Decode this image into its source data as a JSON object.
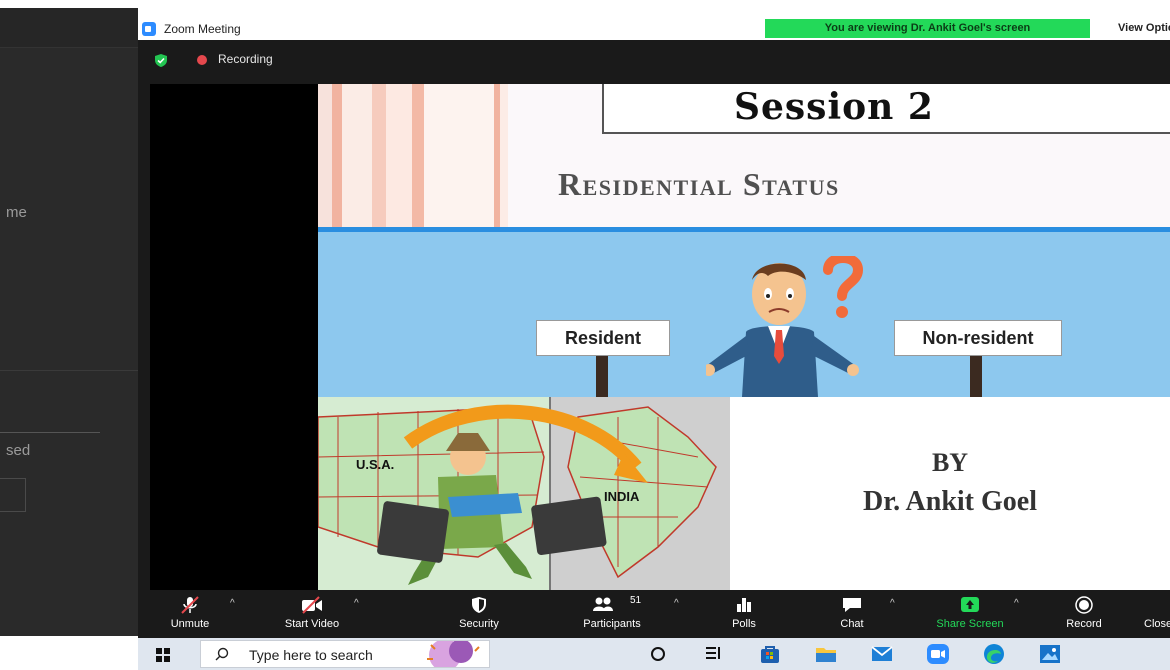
{
  "background_app": {
    "fragment_1": "me",
    "fragment_2": "sed"
  },
  "window": {
    "title": "Zoom Meeting",
    "viewing_banner": "You are viewing Dr. Ankit Goel's screen",
    "view_options": "View Options"
  },
  "status": {
    "recording_label": "Recording"
  },
  "slide": {
    "session_title": "Session 2",
    "heading": "Residential Status",
    "sign_left": "Resident",
    "sign_right": "Non-resident",
    "map_label_usa": "U.S.A.",
    "map_label_india": "INDIA",
    "by": "BY",
    "presenter": "Dr. Ankit Goel"
  },
  "toolbar": {
    "unmute": "Unmute",
    "start_video": "Start Video",
    "security": "Security",
    "participants": "Participants",
    "participants_count": "51",
    "polls": "Polls",
    "chat": "Chat",
    "share_screen": "Share Screen",
    "record": "Record",
    "close": "Close"
  },
  "taskbar": {
    "search_placeholder": "Type here to search"
  },
  "colors": {
    "zoom_blue": "#2d8cff",
    "viewing_green": "#23d959",
    "share_green": "#23d959",
    "recording_red": "#e5484d",
    "slide_blue_line": "#2a8ee0",
    "sky": "#8dc8ee"
  },
  "icons": [
    "zoom-logo-icon",
    "shield-icon",
    "recording-icon",
    "microphone-muted-icon",
    "video-off-icon",
    "security-shield-icon",
    "participants-icon",
    "polls-icon",
    "chat-icon",
    "share-screen-icon",
    "record-icon",
    "windows-start-icon",
    "search-icon",
    "cortana-icon",
    "task-view-icon",
    "store-icon",
    "file-explorer-icon",
    "mail-icon",
    "zoom-app-icon",
    "edge-icon",
    "photos-icon"
  ]
}
